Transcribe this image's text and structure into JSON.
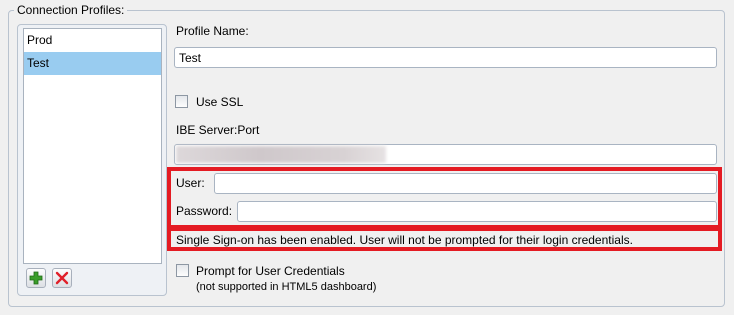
{
  "group": {
    "title": "Connection Profiles:"
  },
  "profiles": {
    "items": [
      {
        "label": "Prod",
        "selected": false
      },
      {
        "label": "Test",
        "selected": true
      }
    ],
    "add_icon": "plus-icon",
    "remove_icon": "x-icon"
  },
  "form": {
    "profile_name_label": "Profile Name:",
    "profile_name_value": "Test",
    "use_ssl_label": "Use SSL",
    "use_ssl_checked": false,
    "server_port_label": "IBE Server:Port",
    "user_label": "User:",
    "user_value": "",
    "password_label": "Password:",
    "password_value": "",
    "sso_message": "Single Sign-on has been enabled.  User will not be prompted for their login credentials.",
    "prompt_label": "Prompt for User Credentials",
    "prompt_note": "(not supported in HTML5 dashboard)",
    "prompt_checked": false
  },
  "colors": {
    "highlight": "#e41b23",
    "selection": "#99ccf0",
    "add_icon": "#3a9d2a",
    "remove_icon": "#e0202a"
  }
}
